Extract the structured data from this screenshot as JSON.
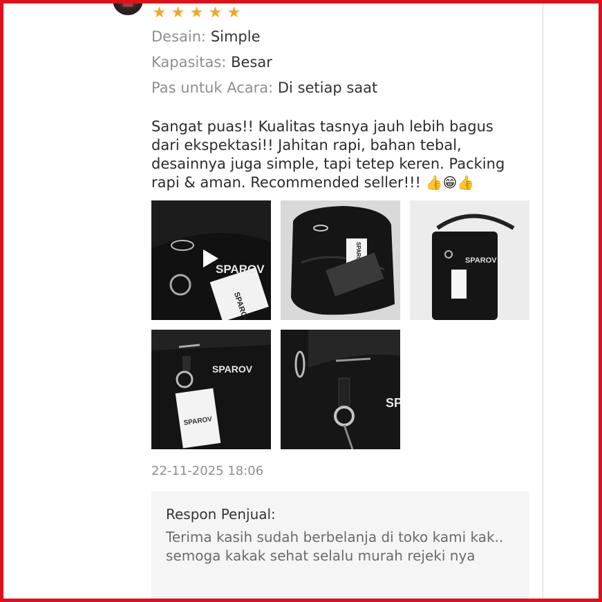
{
  "review": {
    "rating_stars": 5,
    "stars": [
      "★",
      "★",
      "★",
      "★",
      "★"
    ],
    "attributes": [
      {
        "label": "Desain:",
        "value": "Simple"
      },
      {
        "label": "Kapasitas:",
        "value": "Besar"
      },
      {
        "label": "Pas untuk Acara:",
        "value": "Di setiap saat"
      }
    ],
    "text": "Sangat puas!! Kualitas tasnya jauh lebih bagus dari ekspektasi!! Jahitan rapi, bahan tebal, desainnya juga simple, tapi tetep keren. Packing rapi & aman. Recommended seller!!!",
    "emojis": "👍😁👍",
    "media": [
      {
        "type": "video",
        "brand_text": "SPAROV",
        "tag_text": "SPAROV"
      },
      {
        "type": "photo",
        "tag_text": "SPAROV"
      },
      {
        "type": "photo",
        "brand_text": "SPAROV"
      },
      {
        "type": "photo",
        "brand_text": "SPAROV",
        "tag_text": "SPAROV"
      },
      {
        "type": "photo",
        "brand_text": "SP"
      }
    ],
    "timestamp": "22-11-2025 18:06",
    "seller_response": {
      "title": "Respon Penjual:",
      "text": "Terima kasih sudah berbelanja di toko kami kak.. semoga kakak sehat selalu murah rejeki nya"
    }
  },
  "colors": {
    "star": "#f4a623",
    "border": "#e0101b",
    "response_bg": "#f5f5f5"
  }
}
